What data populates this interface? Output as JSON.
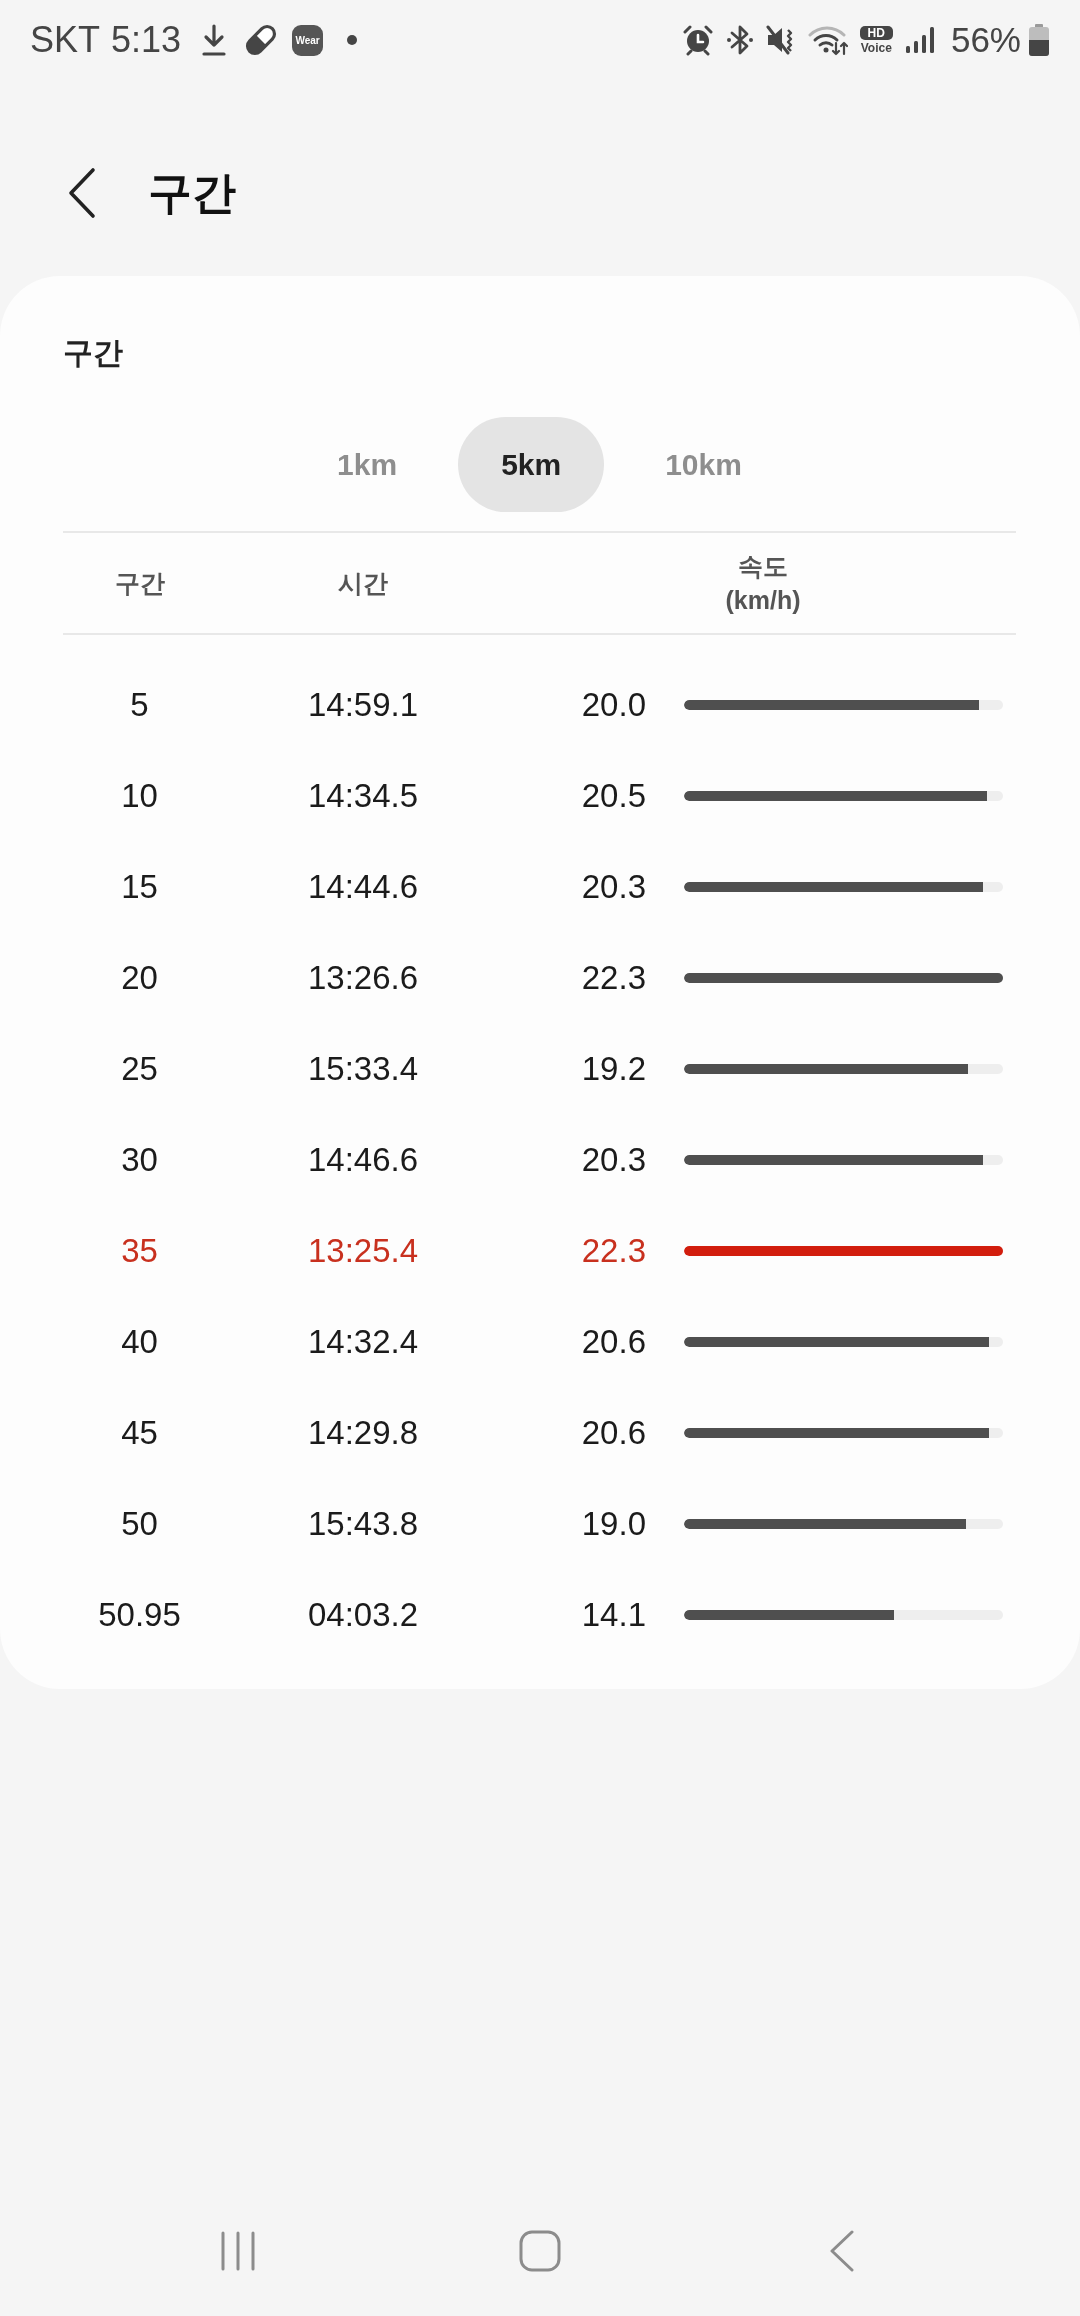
{
  "status_bar": {
    "carrier": "SKT",
    "time": "5:13",
    "badge": "Wear",
    "hd_label": "HD",
    "voice_label": "Voice",
    "battery_percent": "56%"
  },
  "header": {
    "title": "구간"
  },
  "card": {
    "title": "구간",
    "tabs": [
      {
        "label": "1km",
        "selected": false
      },
      {
        "label": "5km",
        "selected": true
      },
      {
        "label": "10km",
        "selected": false
      }
    ],
    "columns": [
      {
        "label": "구간"
      },
      {
        "label": "시간"
      },
      {
        "label": "속도",
        "unit": "(km/h)"
      }
    ],
    "rows": [
      {
        "section": "5",
        "time": "14:59.1",
        "speed": "20.0",
        "level": 0.926,
        "highlighted": false
      },
      {
        "section": "10",
        "time": "14:34.5",
        "speed": "20.5",
        "level": 0.949,
        "highlighted": false
      },
      {
        "section": "15",
        "time": "14:44.6",
        "speed": "20.3",
        "level": 0.937,
        "highlighted": false
      },
      {
        "section": "20",
        "time": "13:26.6",
        "speed": "22.3",
        "level": 1,
        "highlighted": false
      },
      {
        "section": "25",
        "time": "15:33.4",
        "speed": "19.2",
        "level": 0.889,
        "highlighted": false
      },
      {
        "section": "30",
        "time": "14:46.6",
        "speed": "20.3",
        "level": 0.937,
        "highlighted": false
      },
      {
        "section": "35",
        "time": "13:25.4",
        "speed": "22.3",
        "level": 1,
        "highlighted": true
      },
      {
        "section": "40",
        "time": "14:32.4",
        "speed": "20.6",
        "level": 0.957,
        "highlighted": false
      },
      {
        "section": "45",
        "time": "14:29.8",
        "speed": "20.6",
        "level": 0.957,
        "highlighted": false
      },
      {
        "section": "50",
        "time": "15:43.8",
        "speed": "19.0",
        "level": 0.884,
        "highlighted": false
      },
      {
        "section": "50.95",
        "time": "04:03.2",
        "speed": "14.1",
        "level": 0.658,
        "highlighted": false
      }
    ]
  }
}
